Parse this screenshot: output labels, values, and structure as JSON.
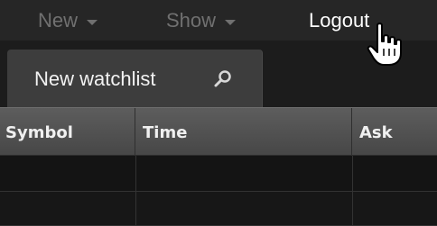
{
  "menubar": {
    "new_label": "New",
    "show_label": "Show",
    "logout_label": "Logout"
  },
  "tab": {
    "label": "New watchlist",
    "icon": "search-icon"
  },
  "cursor": {
    "icon": "hand-pointer-icon"
  },
  "table": {
    "columns": [
      "Symbol",
      "Time",
      "Ask"
    ],
    "rows": [
      [
        "",
        "",
        ""
      ],
      [
        "",
        "",
        ""
      ]
    ]
  },
  "colors": {
    "menubar_bg": "#262626",
    "menu_text_dim": "#707070",
    "menu_text_active": "#ffffff",
    "tab_bg": "#3d3d3d",
    "header_bg": "#555555",
    "row_bg": "#141414"
  }
}
